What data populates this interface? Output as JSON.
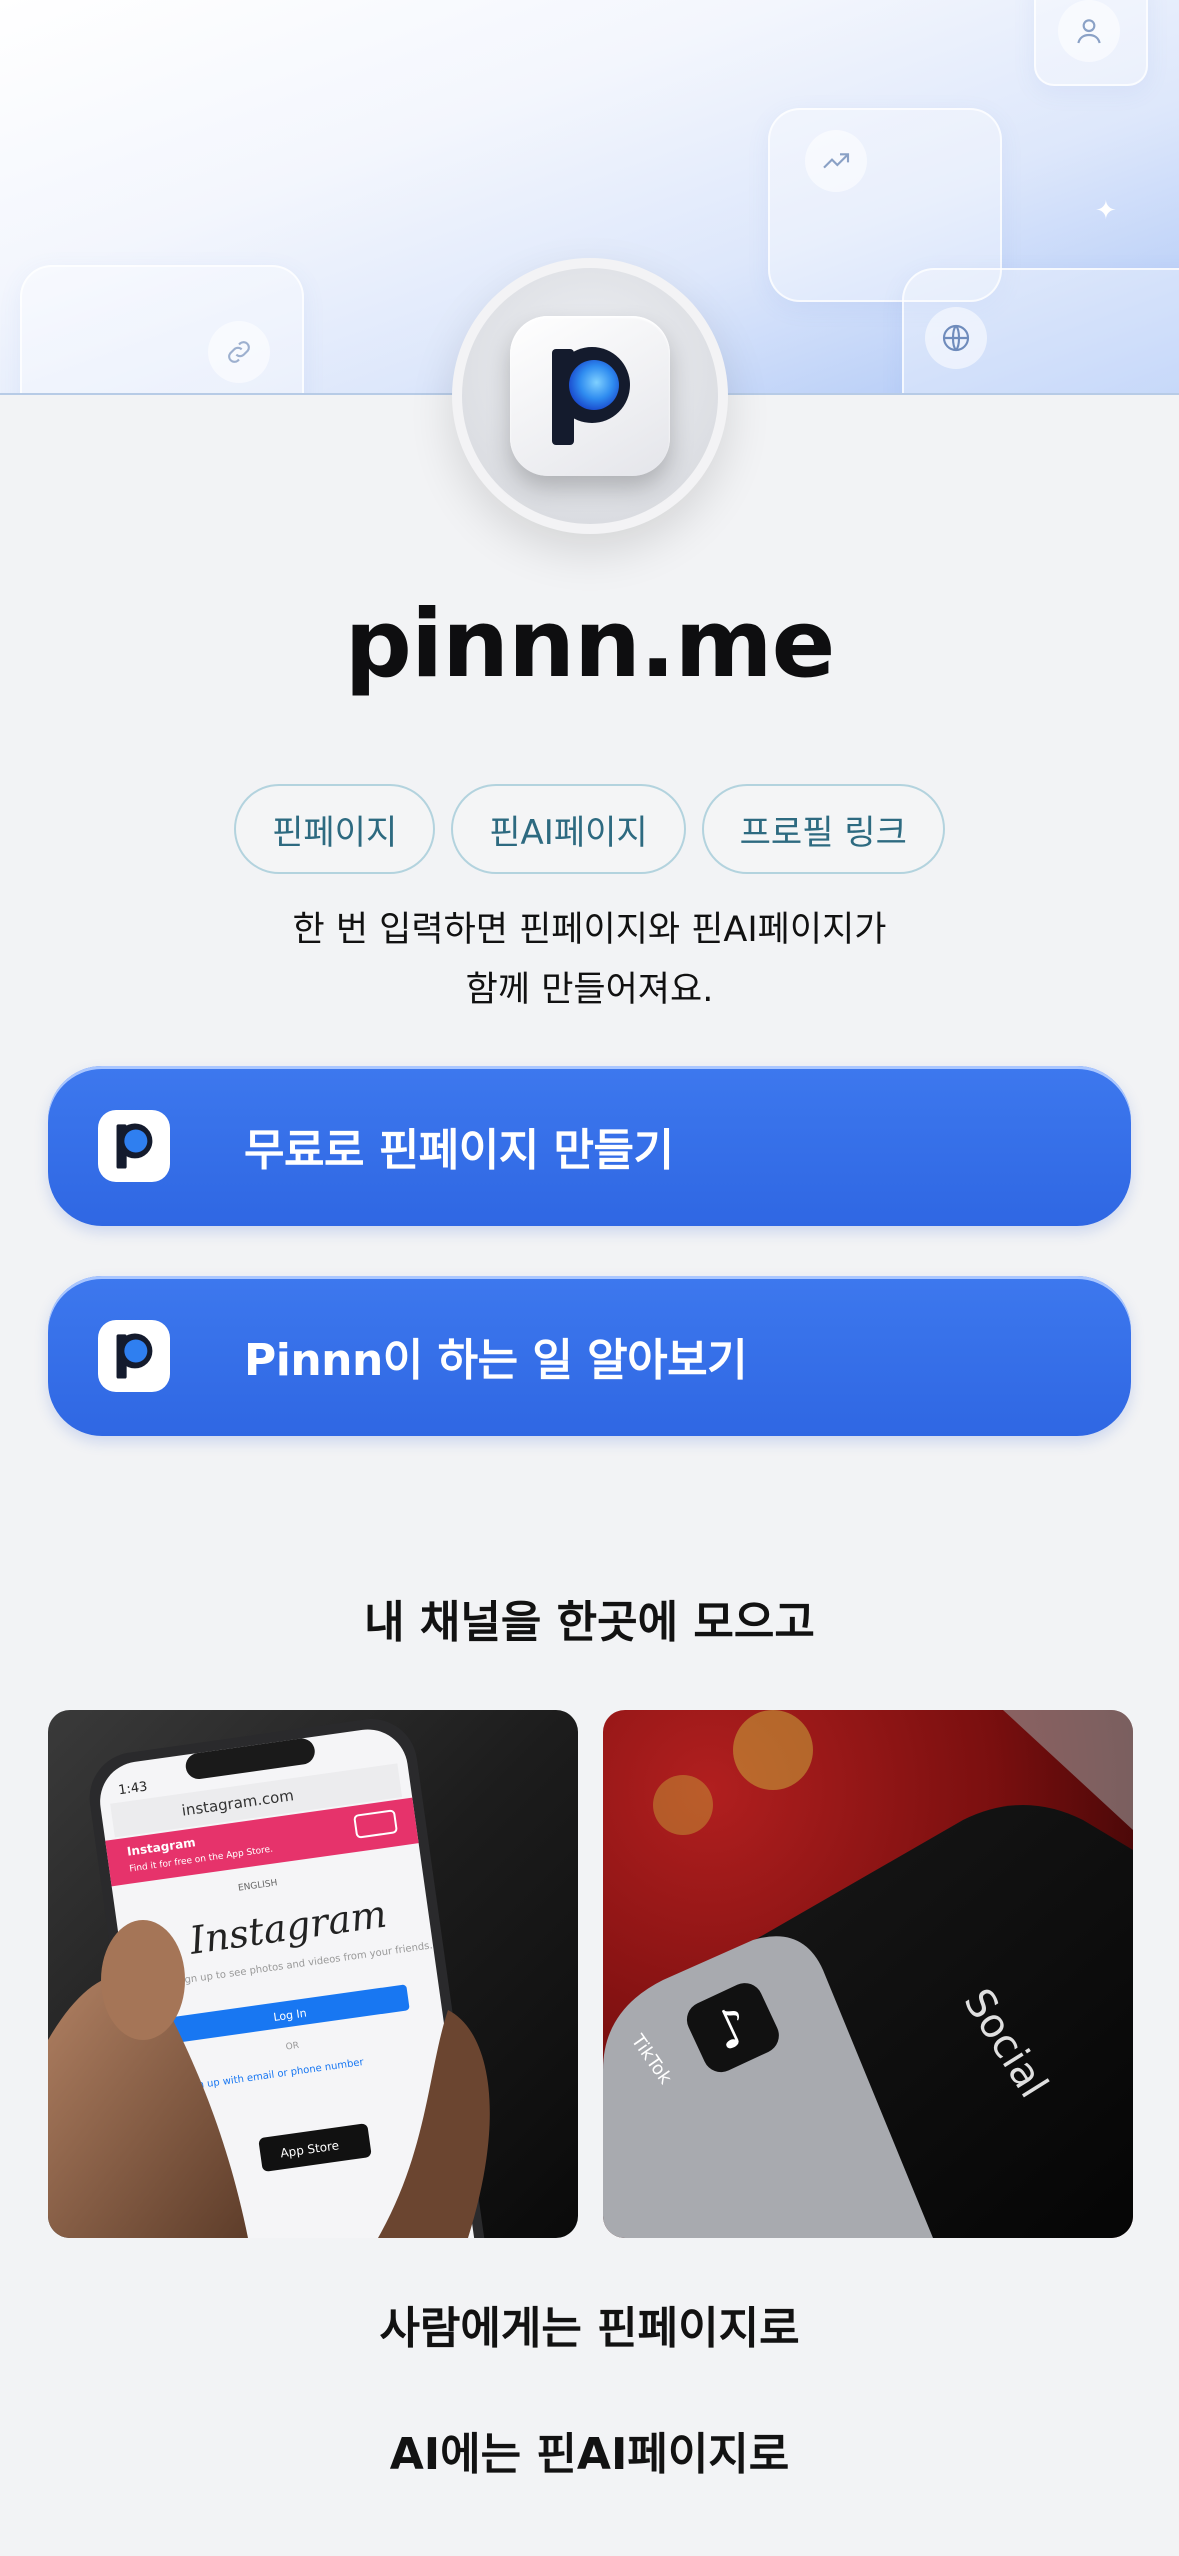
{
  "hero": {
    "icons": [
      "person-icon",
      "trend-icon",
      "link-icon",
      "globe-icon"
    ]
  },
  "site": {
    "title": "pinnn.me",
    "logo_letter": "p"
  },
  "chips": [
    "핀페이지",
    "핀AI페이지",
    "프로필 링크"
  ],
  "description": {
    "line1": "한 번 입력하면 핀페이지와 핀AI페이지가",
    "line2": "함께 만들어져요."
  },
  "buttons": {
    "create_label": "무료로 핀페이지 만들기",
    "learn_label": "Pinnn이 하는 일 알아보기"
  },
  "sections": {
    "channels_heading": "내 채널을 한곳에 모으고",
    "people_heading": "사람에게는 핀페이지로",
    "ai_heading": "AI에는 핀AI페이지로"
  },
  "photos": {
    "instagram": {
      "url": "instagram.com",
      "app_name": "Instagram",
      "banner": "Instagram",
      "banner_sub": "Find it for free on the App Store.",
      "language": "ENGLISH",
      "tagline": "Sign up to see photos and videos from your friends.",
      "login": "Log In",
      "or": "OR",
      "signup": "Sign up with email or phone number",
      "badge": "App Store",
      "time": "1:43"
    },
    "tiktok": {
      "app_label": "TikTok",
      "folder_label": "Social"
    }
  },
  "colors": {
    "primary": "#3572E9",
    "chip_border": "#B3D3DE",
    "chip_text": "#2D6A80",
    "background": "#F2F3F5"
  }
}
